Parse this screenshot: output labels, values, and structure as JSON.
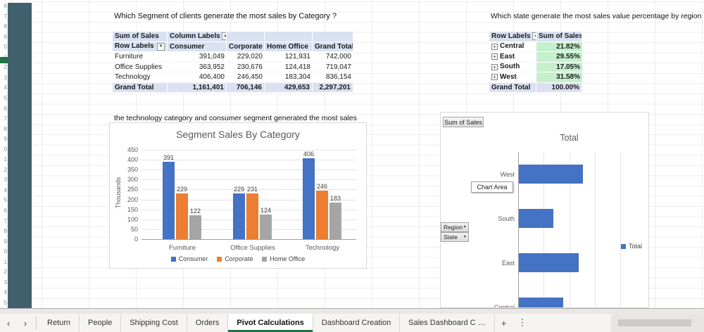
{
  "colors": {
    "accent": "#217346",
    "pivot_header_fill": "#D9E1F2",
    "highlight_green": "#C6EFCE",
    "series_blue": "#4472C4",
    "series_orange": "#ED7D31",
    "series_gray": "#A5A5A5",
    "dark_column": "#41606d"
  },
  "icons": {
    "dropdown": "▼",
    "expand": "+",
    "nav_left": "‹",
    "nav_right": "›",
    "add": "+",
    "more": "⋮"
  },
  "sheet": {
    "row_digits": [
      "6",
      "7",
      "8",
      "9",
      "0",
      "1",
      "2",
      "3",
      "4",
      "5",
      "6",
      "7",
      "8",
      "9",
      "0",
      "1",
      "2",
      "3",
      "4",
      "5",
      "6",
      "7",
      "8",
      "9",
      "0",
      "1",
      "2",
      "3",
      "4",
      "5"
    ]
  },
  "questions": {
    "q1": "Which Segment of clients generate the most sales by Category ?",
    "q2": "Which state generate the most sales value percentage by region ?"
  },
  "note": "the technology category and consumer segment generated the most sales",
  "pivot_segment": {
    "corner": "Sum of Sales",
    "column_labels": "Column Labels",
    "row_labels": "Row Labels",
    "columns": [
      "Consumer",
      "Corporate",
      "Home Office",
      "Grand Total"
    ],
    "rows": [
      {
        "label": "Furniture",
        "values": [
          "391,049",
          "229,020",
          "121,931",
          "742,000"
        ]
      },
      {
        "label": "Office Supplies",
        "values": [
          "363,952",
          "230,676",
          "124,418",
          "719,047"
        ]
      },
      {
        "label": "Technology",
        "values": [
          "406,400",
          "246,450",
          "183,304",
          "836,154"
        ]
      }
    ],
    "grand_total": {
      "label": "Grand Total",
      "values": [
        "1,161,401",
        "706,146",
        "429,653",
        "2,297,201"
      ]
    }
  },
  "pivot_region": {
    "row_labels": "Row Labels",
    "value_header": "Sum of Sales",
    "rows": [
      {
        "label": "Central",
        "value": "21.82%"
      },
      {
        "label": "East",
        "value": "29.55%"
      },
      {
        "label": "South",
        "value": "17.05%"
      },
      {
        "label": "West",
        "value": "31.58%"
      }
    ],
    "grand_total": {
      "label": "Grand Total",
      "value": "100.00%"
    }
  },
  "chart_data": [
    {
      "type": "bar",
      "title": "Segment Sales By Category",
      "ylabel": "Thousands",
      "ylim": [
        0,
        450
      ],
      "ytick_step": 50,
      "grid": true,
      "legend_position": "bottom",
      "categories": [
        "Furniture",
        "Office Supplies",
        "Technology"
      ],
      "series": [
        {
          "name": "Consumer",
          "color": "#4472C4",
          "values": [
            391,
            229,
            406
          ]
        },
        {
          "name": "Corporate",
          "color": "#ED7D31",
          "values": [
            229,
            231,
            246
          ]
        },
        {
          "name": "Home Office",
          "color": "#A5A5A5",
          "values": [
            122,
            124,
            183
          ]
        }
      ]
    },
    {
      "type": "bar",
      "orientation": "horizontal",
      "title": "Total",
      "grid": true,
      "legend_position": "right",
      "x_axis_visible": false,
      "categories": [
        "West",
        "South",
        "East",
        "Central"
      ],
      "series": [
        {
          "name": "Total",
          "color": "#4472C4",
          "values": [
            31.58,
            17.05,
            29.55,
            21.82
          ]
        }
      ],
      "field_buttons": [
        "Sum of Sales",
        "Region",
        "State"
      ],
      "tooltip": "Chart Area"
    }
  ],
  "tabs": {
    "items": [
      {
        "label": "Return",
        "active": false
      },
      {
        "label": "People",
        "active": false
      },
      {
        "label": "Shipping Cost",
        "active": false
      },
      {
        "label": "Orders",
        "active": false
      },
      {
        "label": "Pivot Calculations",
        "active": true
      },
      {
        "label": "Dashboard Creation",
        "active": false
      },
      {
        "label": "Sales Dashboard C …",
        "active": false
      }
    ],
    "add_label": "+",
    "more_label": "⋮"
  }
}
